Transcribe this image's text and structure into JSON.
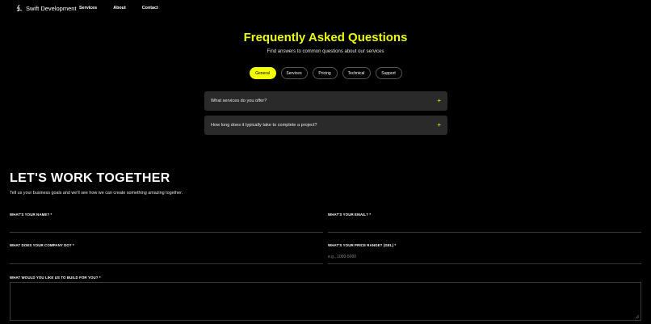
{
  "nav": {
    "brand": "Swift Development",
    "links": [
      "Services",
      "About",
      "Contact"
    ]
  },
  "faq": {
    "title": "Frequently Asked Questions",
    "subtitle": "Find answers to common questions about our services",
    "tabs": [
      "General",
      "Services",
      "Pricing",
      "Technical",
      "Support"
    ],
    "active_tab": "General",
    "questions": [
      "What services do you offer?",
      "How long does it typically take to complete a project?"
    ],
    "expand_symbol": "+"
  },
  "contact": {
    "title": "LET'S WORK TOGETHER",
    "description": "Tell us your business goals and we'll see how we can create something amazing together.",
    "fields": {
      "name_label": "WHAT'S YOUR NAME? *",
      "email_label": "WHAT'S YOUR EMAIL? *",
      "company_label": "WHAT DOES YOUR COMPANY DO? *",
      "price_label": "WHAT'S YOUR PRICE RANGE? (GEL) *",
      "price_placeholder": "e.g., 1000-5000",
      "build_label": "WHAT WOULD YOU LIKE US TO BUILD FOR YOU? *"
    }
  },
  "colors": {
    "accent": "#f2ff00",
    "background": "#000000",
    "card": "#2a2a2a"
  }
}
